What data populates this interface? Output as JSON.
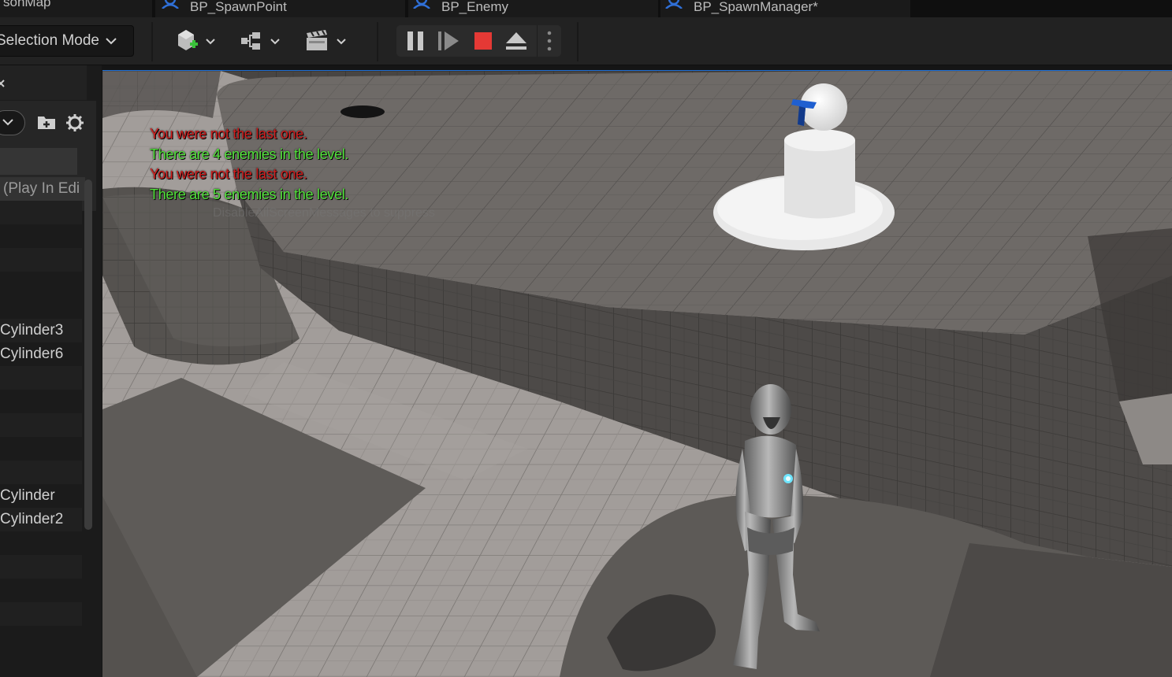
{
  "tabs": [
    {
      "label": "sonMap"
    },
    {
      "label": "BP_SpawnPoint"
    },
    {
      "label": "BP_Enemy"
    },
    {
      "label": "BP_SpawnManager*"
    }
  ],
  "toolbar": {
    "mode_label": "Selection Mode",
    "icons": [
      "add-actor-icon",
      "blueprint-icon",
      "cinematics-icon",
      "pause-icon",
      "skip-frame-icon",
      "stop-icon",
      "eject-icon",
      "more-options-icon"
    ],
    "stop_color": "#e53935"
  },
  "outliner": {
    "rows": [
      {
        "label": "(Play In Edi"
      },
      {
        "label": ""
      },
      {
        "label": ""
      },
      {
        "label": ""
      },
      {
        "label": ""
      },
      {
        "label": "Cylinder3"
      },
      {
        "label": "Cylinder6"
      },
      {
        "label": ""
      },
      {
        "label": ""
      },
      {
        "label": ""
      },
      {
        "label": ""
      },
      {
        "label": ""
      },
      {
        "label": "Cylinder"
      },
      {
        "label": "Cylinder2"
      },
      {
        "label": ""
      },
      {
        "label": ""
      },
      {
        "label": ""
      },
      {
        "label": ""
      },
      {
        "label": ""
      }
    ]
  },
  "viewport": {
    "messages": [
      {
        "text": "You were not the last one.",
        "kind": "red"
      },
      {
        "text": "There are 4 enemies in the level.",
        "kind": "green"
      },
      {
        "text": "You were not the last one.",
        "kind": "red"
      },
      {
        "text": "There are 5 enemies in the level.",
        "kind": "green"
      }
    ],
    "suppress_hint": "DisableAllScreenMessages to suppress"
  }
}
